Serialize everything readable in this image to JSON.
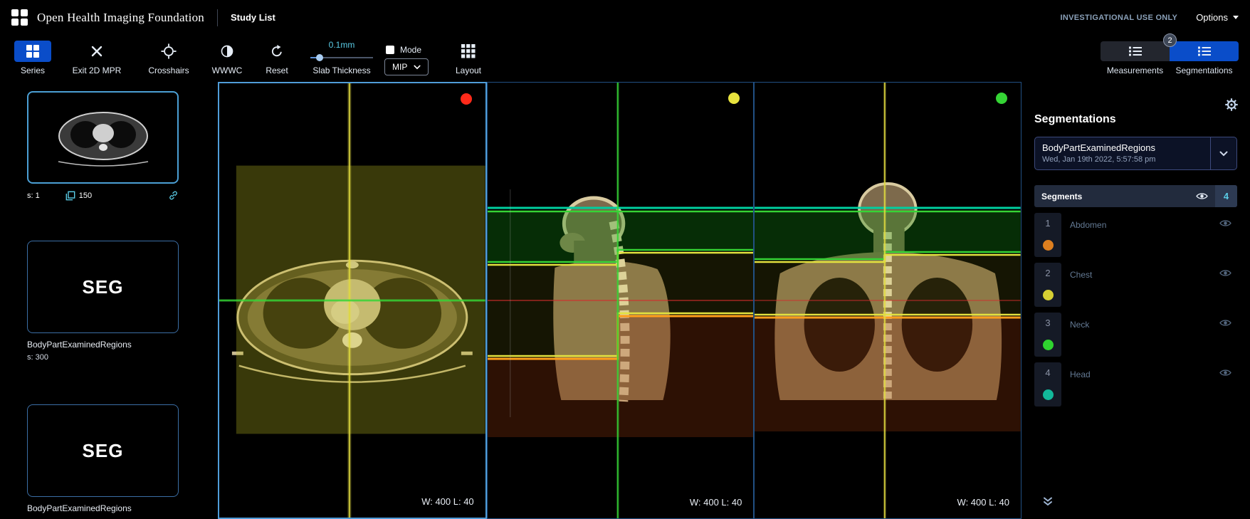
{
  "header": {
    "app_name": "Open Health Imaging Foundation",
    "study_list": "Study List",
    "investigational": "INVESTIGATIONAL USE ONLY",
    "options": "Options"
  },
  "toolbar": {
    "series": "Series",
    "exit_mpr": "Exit 2D MPR",
    "crosshairs": "Crosshairs",
    "wwwc": "WWWC",
    "reset": "Reset",
    "slab_value": "0.1mm",
    "slab_label": "Slab Thickness",
    "mode_label": "Mode",
    "mip_value": "MIP",
    "layout": "Layout",
    "measurements": "Measurements",
    "segmentations": "Segmentations",
    "segmentations_badge": "2",
    "accent_blue": "#0a4dc9",
    "accent_cyan": "#5acce6"
  },
  "study_panel": {
    "thumbnails": [
      {
        "type": "image",
        "series_info": "s: 1",
        "instance_count": "150"
      },
      {
        "type": "seg",
        "label": "SEG",
        "description": "BodyPartExaminedRegions",
        "series_info": "s: 300"
      },
      {
        "type": "seg",
        "label": "SEG",
        "description": "BodyPartExaminedRegions"
      }
    ]
  },
  "viewports": [
    {
      "name": "axial",
      "marker_color": "#ff2a1a",
      "wl": "W: 400 L: 40"
    },
    {
      "name": "sagittal",
      "marker_color": "#e8e33e",
      "wl": "W: 400 L: 40"
    },
    {
      "name": "coronal",
      "marker_color": "#35d435",
      "wl": "W: 400 L: 40"
    }
  ],
  "seg_panel": {
    "title": "Segmentations",
    "active_segmentation": "BodyPartExaminedRegions",
    "active_segmentation_date": "Wed, Jan 19th 2022, 5:57:58 pm",
    "segments_header": "Segments",
    "visible_count": "4",
    "segments": [
      {
        "index": "1",
        "label": "Abdomen",
        "color": "#dd7f1f"
      },
      {
        "index": "2",
        "label": "Chest",
        "color": "#d6cf33"
      },
      {
        "index": "3",
        "label": "Neck",
        "color": "#2fd42f"
      },
      {
        "index": "4",
        "label": "Head",
        "color": "#12b89a"
      }
    ]
  },
  "icons": {
    "logo": "grid-2x2",
    "series": "grid-2x2-filled",
    "exit_mpr": "x",
    "crosshairs": "crosshair-circle",
    "wwwc": "half-filled-circle",
    "reset": "rotate-ccw-arrow",
    "layout": "grid-3x3",
    "panel_toggle": "list",
    "eye": "eye",
    "gear": "gear",
    "chevron_down": "chevron-down",
    "collapse": "double-chevron-down",
    "link": "link",
    "stack": "stack"
  }
}
